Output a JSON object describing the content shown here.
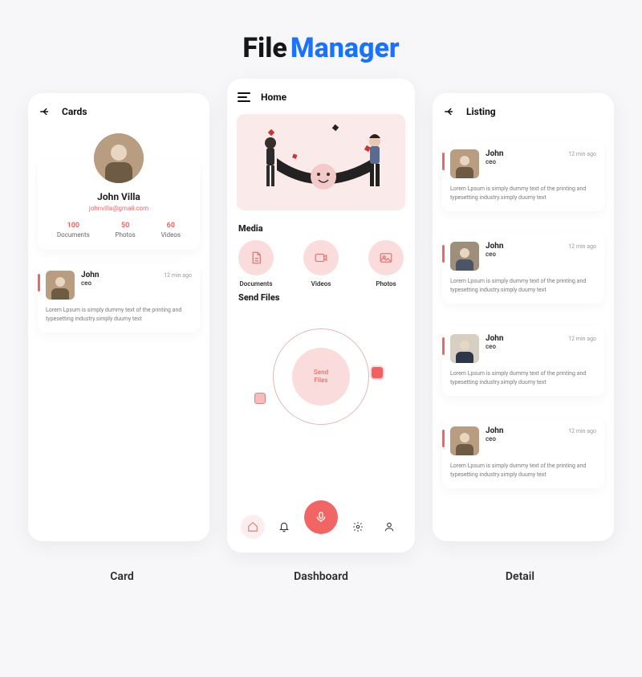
{
  "title": {
    "part1": "File",
    "part2": "Manager"
  },
  "captions": {
    "card": "Card",
    "dashboard": "Dashboard",
    "detail": "Detail"
  },
  "card": {
    "header": "Cards",
    "profile": {
      "name": "John Villa",
      "email": "johnvilla@gmail.com",
      "stats": {
        "documents": {
          "value": "100",
          "label": "Documents"
        },
        "photos": {
          "value": "50",
          "label": "Photos"
        },
        "videos": {
          "value": "60",
          "label": "Videos"
        }
      }
    },
    "item": {
      "name": "John",
      "role": "ceo",
      "time": "12 min ago",
      "body": "Lorem Lpsum is simply dummy text of the printing and typesetting industry.simply duumy text"
    }
  },
  "dashboard": {
    "header": "Home",
    "media": {
      "title": "Media",
      "items": [
        {
          "label": "Documents",
          "icon": "document-icon"
        },
        {
          "label": "Videos",
          "icon": "video-icon"
        },
        {
          "label": "Photos",
          "icon": "photo-icon"
        }
      ]
    },
    "send": {
      "title": "Send Files",
      "center": "Send\nFiles"
    }
  },
  "listing": {
    "header": "Listing",
    "items": [
      {
        "name": "John",
        "role": "ceo",
        "time": "12 min ago",
        "body": "Lorem Lpsum is simply dummy text of the printing and typesetting industry.simply duumy text"
      },
      {
        "name": "John",
        "role": "ceo",
        "time": "12 min ago",
        "body": "Lorem Lpsum is simply dummy text of the printing and typesetting industry.simply duumy text"
      },
      {
        "name": "John",
        "role": "ceo",
        "time": "12 min ago",
        "body": "Lorem Lpsum is simply dummy text of the printing and typesetting industry.simply duumy text"
      },
      {
        "name": "John",
        "role": "ceo",
        "time": "12 min ago",
        "body": "Lorem Lpsum is simply dummy text of the printing and typesetting industry.simply duumy text"
      }
    ]
  }
}
